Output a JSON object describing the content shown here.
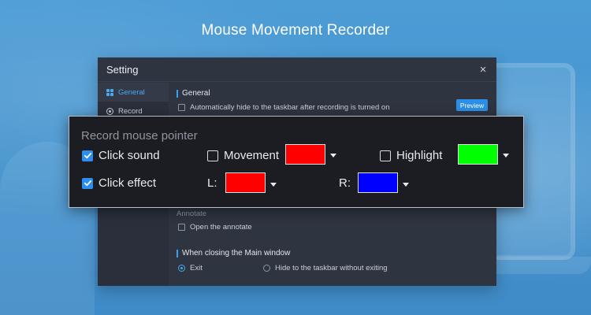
{
  "banner_title": "Mouse Movement Recorder",
  "window": {
    "title": "Setting",
    "close_label": "×",
    "sidebar": [
      {
        "label": "General",
        "icon": "grid-icon",
        "active": true
      },
      {
        "label": "Record",
        "icon": "record-icon",
        "active": false
      }
    ],
    "general": {
      "title": "General",
      "auto_hide_label": "Automatically hide to the taskbar after recording is turned on",
      "auto_hide_checked": false,
      "preview_label": "Preview"
    },
    "annotate": {
      "title": "Annotate",
      "open_annotate_label": "Open the annotate",
      "open_annotate_checked": false
    },
    "closing": {
      "title": "When closing the Main window",
      "options": [
        {
          "label": "Exit",
          "selected": true
        },
        {
          "label": "Hide to the taskbar without exiting",
          "selected": false
        }
      ]
    }
  },
  "pointer_panel": {
    "title": "Record mouse pointer",
    "click_sound": {
      "label": "Click sound",
      "checked": true
    },
    "movement": {
      "label": "Movement",
      "checked": false,
      "color": "#ff0000"
    },
    "highlight": {
      "label": "Highlight",
      "checked": false,
      "color": "#00ff00"
    },
    "click_effect": {
      "label": "Click effect",
      "checked": true
    },
    "left_click": {
      "label": "L:",
      "color": "#ff0000"
    },
    "right_click": {
      "label": "R:",
      "color": "#0000ff"
    }
  }
}
